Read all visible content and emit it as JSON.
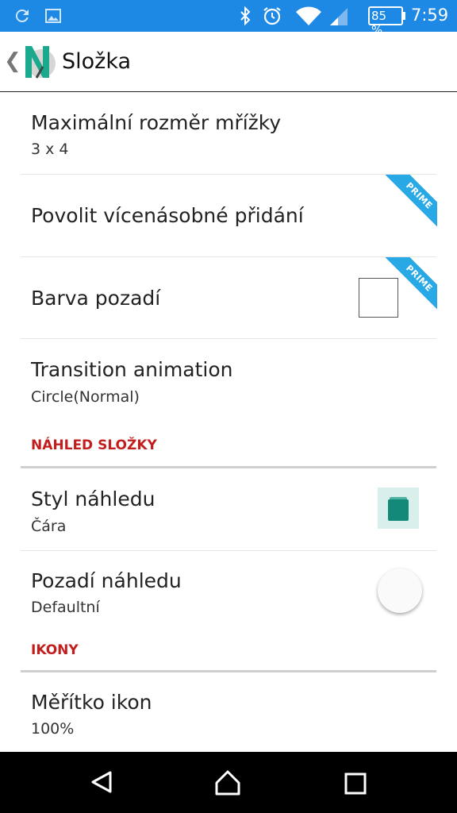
{
  "status_bar": {
    "battery_percent": "85 %",
    "time": "7:59",
    "icons": [
      "sync-icon",
      "image-icon",
      "bluetooth-icon",
      "alarm-icon",
      "wifi-icon",
      "signal-icon",
      "battery-icon"
    ]
  },
  "toolbar": {
    "back_glyph": "❮",
    "title": "Složka",
    "logo_letter": "N"
  },
  "settings": {
    "max_grid": {
      "title": "Maximální rozměr mřížky",
      "summary": "3 x 4"
    },
    "multi_add": {
      "title": "Povolit vícenásobné přidání",
      "badge": "PRIME"
    },
    "background_color": {
      "title": "Barva pozadí",
      "badge": "PRIME",
      "swatch_color": "#ffffff"
    },
    "transition": {
      "title": "Transition animation",
      "summary": "Circle(Normal)"
    }
  },
  "section_folder_preview": {
    "header": "NÁHLED SLOŽKY",
    "style": {
      "title": "Styl náhledu",
      "summary": "Čára"
    },
    "background": {
      "title": "Pozadí náhledu",
      "summary": "Defaultní"
    }
  },
  "section_icons": {
    "header": "IKONY",
    "scale": {
      "title": "Měřítko ikon",
      "summary": "100%"
    }
  },
  "colors": {
    "status_bar": "#1e88e5",
    "section_header": "#c21e1e",
    "prime_ribbon": "#29a8e6",
    "preview_accent": "#138a79"
  }
}
